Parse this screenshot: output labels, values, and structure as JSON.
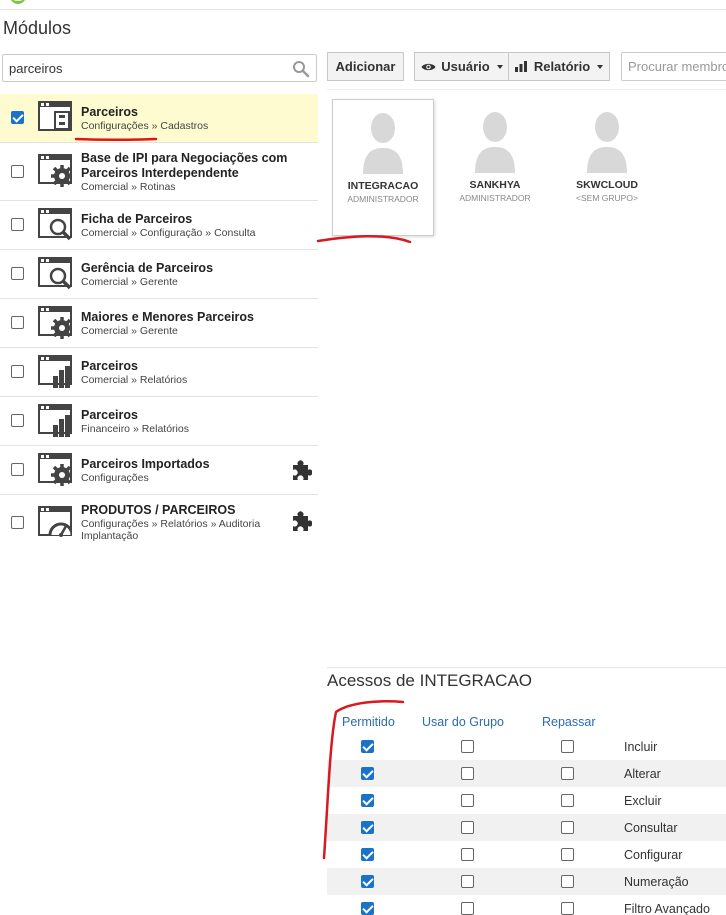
{
  "header": {
    "title": "Módulos"
  },
  "search": {
    "value": "parceiros"
  },
  "modules": [
    {
      "name": "Parceiros",
      "path": "Configurações » Cadastros",
      "checked": true,
      "icon": "form-window-icon"
    },
    {
      "name": "Base de IPI para Negociações com Parceiros Interdependente",
      "path": "Comercial » Rotinas",
      "checked": false,
      "icon": "gear-window-icon"
    },
    {
      "name": "Ficha de Parceiros",
      "path": "Comercial » Configuração » Consulta",
      "checked": false,
      "icon": "magnifier-window-icon"
    },
    {
      "name": "Gerência de Parceiros",
      "path": "Comercial » Gerente",
      "checked": false,
      "icon": "magnifier-window-icon"
    },
    {
      "name": "Maiores e Menores Parceiros",
      "path": "Comercial » Gerente",
      "checked": false,
      "icon": "gear-window-icon"
    },
    {
      "name": "Parceiros",
      "path": "Comercial » Relatórios",
      "checked": false,
      "icon": "bar-chart-window-icon"
    },
    {
      "name": "Parceiros",
      "path": "Financeiro » Relatórios",
      "checked": false,
      "icon": "bar-chart-window-icon"
    },
    {
      "name": "Parceiros Importados",
      "path": "Configurações",
      "checked": false,
      "icon": "gear-window-icon",
      "extension": "puzzle-icon"
    },
    {
      "name": "PRODUTOS / PARCEIROS",
      "path": "Configurações » Relatórios » Auditoria Implantação",
      "checked": false,
      "icon": "gauge-window-icon",
      "extension": "puzzle-icon"
    }
  ],
  "toolbar": {
    "add_label": "Adicionar",
    "user_label": "Usuário",
    "report_label": "Relatório",
    "search_placeholder": "Procurar membros"
  },
  "users": [
    {
      "name": "INTEGRACAO",
      "group": "ADMINISTRADOR",
      "selected": true
    },
    {
      "name": "SANKHYA",
      "group": "ADMINISTRADOR",
      "selected": false
    },
    {
      "name": "SKWCLOUD",
      "group": "<SEM GRUPO>",
      "selected": false
    }
  ],
  "access": {
    "title": "Acessos de INTEGRACAO",
    "columns": [
      "Permitido",
      "Usar do Grupo",
      "Repassar"
    ],
    "rows": [
      {
        "label": "Incluir",
        "permitted": true,
        "use_group": false,
        "pass_on": false
      },
      {
        "label": "Alterar",
        "permitted": true,
        "use_group": false,
        "pass_on": false
      },
      {
        "label": "Excluir",
        "permitted": true,
        "use_group": false,
        "pass_on": false
      },
      {
        "label": "Consultar",
        "permitted": true,
        "use_group": false,
        "pass_on": false
      },
      {
        "label": "Configurar",
        "permitted": true,
        "use_group": false,
        "pass_on": false
      },
      {
        "label": "Numeração",
        "permitted": true,
        "use_group": false,
        "pass_on": false
      },
      {
        "label": "Filtro Avançado",
        "permitted": true,
        "use_group": false,
        "pass_on": false
      }
    ]
  },
  "colors": {
    "accent_blue": "#1a73c8",
    "selected_row": "#fefbd1",
    "column_header": "#2a6cb0",
    "annotation_red": "#d71920"
  }
}
